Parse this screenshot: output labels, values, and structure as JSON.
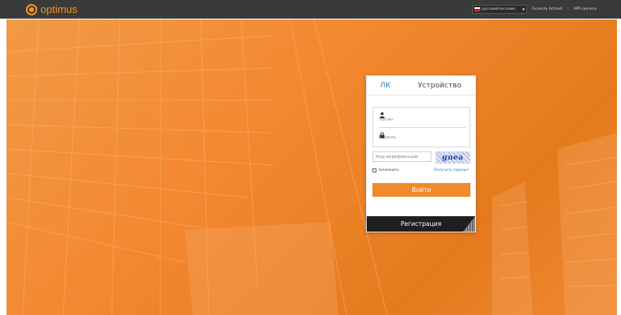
{
  "brand": {
    "name": "optimus",
    "icon": "optimus-logo-icon",
    "color": "#f7941d"
  },
  "topbar": {
    "language": "русский(Русский)",
    "language_flag": "russia-flag-icon",
    "links": [
      "Скачать ActiveX",
      "APP скачать"
    ],
    "separator": "|"
  },
  "login": {
    "tabs": [
      {
        "label": "ЛК",
        "active": true
      },
      {
        "label": "Устройство",
        "active": false
      }
    ],
    "username": {
      "placeholder": "Логин",
      "value": "",
      "icon": "user-icon"
    },
    "password": {
      "placeholder": "Пароль",
      "value": "",
      "icon": "lock-icon"
    },
    "captcha": {
      "placeholder": "Код верификации",
      "value": "",
      "image_text": "gnea"
    },
    "remember_label": "Запомнить",
    "forgot_label": "Получить пароль?",
    "submit_label": "Войти",
    "register_label": "Регистрация",
    "qr_icon": "qr-code-icon"
  },
  "colors": {
    "accent": "#f08a2a",
    "link": "#2a7ec6",
    "topbar": "#3a3a3a",
    "register_bar": "#1f1f1f"
  }
}
